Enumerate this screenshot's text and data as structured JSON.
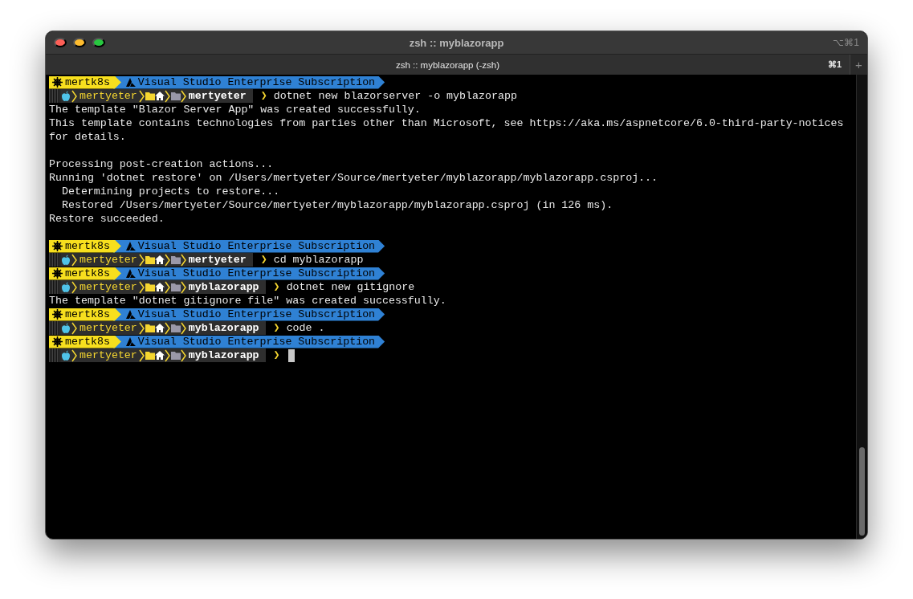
{
  "window": {
    "title": "zsh :: myblazorapp",
    "shortcut": "⌥⌘1"
  },
  "tabs": [
    {
      "label": "zsh :: myblazorapp (-zsh)",
      "shortcut": "⌘1",
      "selected": true
    }
  ],
  "new_tab": "+",
  "lines": [
    {
      "kind": "context",
      "cluster": "mertk8s",
      "subscription": "Visual Studio Enterprise Subscription"
    },
    {
      "kind": "prompt",
      "user": "mertyeter",
      "dir": "mertyeter",
      "symbol": "❯",
      "command": "dotnet new blazorserver -o myblazorapp"
    },
    {
      "kind": "output",
      "text": "The template \"Blazor Server App\" was created successfully."
    },
    {
      "kind": "output",
      "text": "This template contains technologies from parties other than Microsoft, see https://aka.ms/aspnetcore/6.0-third-party-notices"
    },
    {
      "kind": "output",
      "text": "for details."
    },
    {
      "kind": "blank"
    },
    {
      "kind": "output",
      "text": "Processing post-creation actions..."
    },
    {
      "kind": "output",
      "text": "Running 'dotnet restore' on /Users/mertyeter/Source/mertyeter/myblazorapp/myblazorapp.csproj..."
    },
    {
      "kind": "output",
      "text": "  Determining projects to restore..."
    },
    {
      "kind": "output",
      "text": "  Restored /Users/mertyeter/Source/mertyeter/myblazorapp/myblazorapp.csproj (in 126 ms)."
    },
    {
      "kind": "output",
      "text": "Restore succeeded."
    },
    {
      "kind": "blank"
    },
    {
      "kind": "context",
      "cluster": "mertk8s",
      "subscription": "Visual Studio Enterprise Subscription"
    },
    {
      "kind": "prompt",
      "user": "mertyeter",
      "dir": "mertyeter",
      "symbol": "❯",
      "command": "cd myblazorapp"
    },
    {
      "kind": "context",
      "cluster": "mertk8s",
      "subscription": "Visual Studio Enterprise Subscription"
    },
    {
      "kind": "prompt",
      "user": "mertyeter",
      "dir": "myblazorapp",
      "symbol": "❯",
      "command": "dotnet new gitignore"
    },
    {
      "kind": "output",
      "text": "The template \"dotnet gitignore file\" was created successfully."
    },
    {
      "kind": "context",
      "cluster": "mertk8s",
      "subscription": "Visual Studio Enterprise Subscription"
    },
    {
      "kind": "prompt",
      "user": "mertyeter",
      "dir": "myblazorapp",
      "symbol": "❯",
      "command": "code ."
    },
    {
      "kind": "context",
      "cluster": "mertk8s",
      "subscription": "Visual Studio Enterprise Subscription"
    },
    {
      "kind": "prompt",
      "user": "mertyeter",
      "dir": "myblazorapp",
      "symbol": "❯",
      "cursor": true
    }
  ]
}
